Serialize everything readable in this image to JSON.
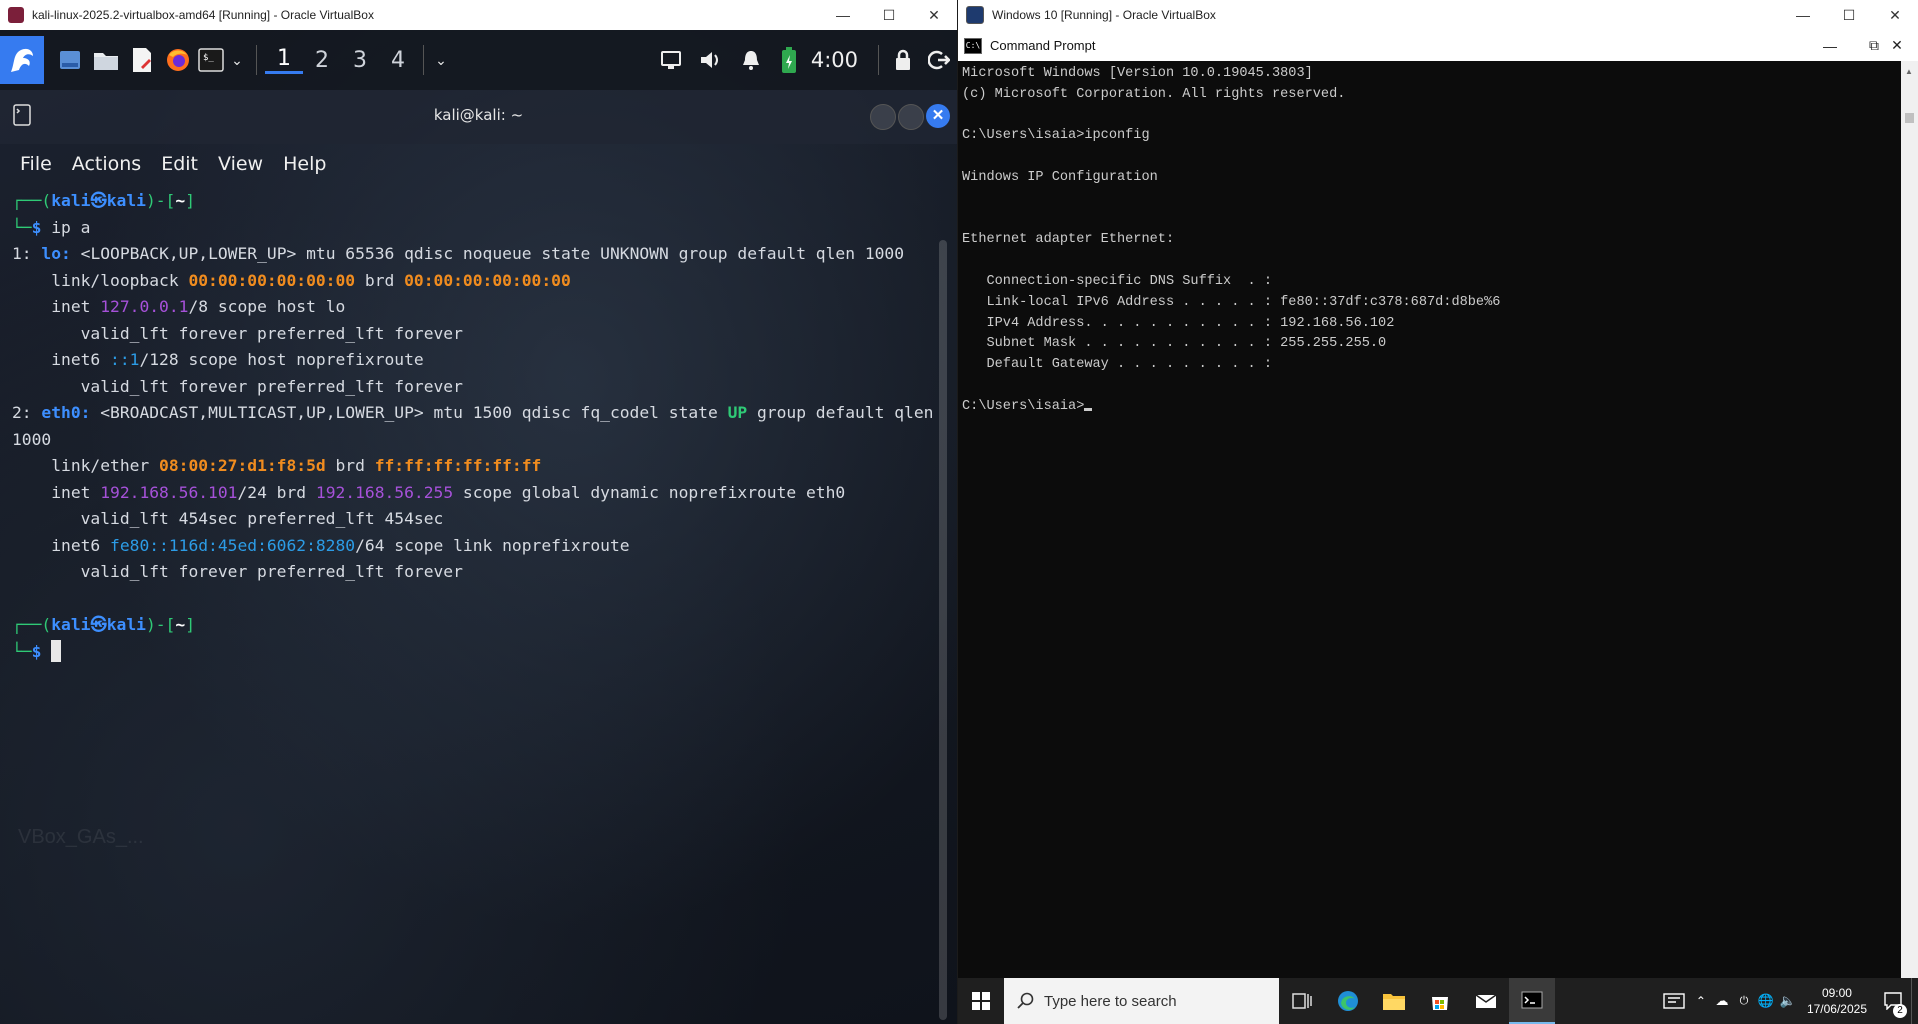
{
  "kali_window": {
    "title": "kali-linux-2025.2-virtualbox-amd64 [Running] - Oracle VirtualBox",
    "panel": {
      "workspaces": [
        "1",
        "2",
        "3",
        "4"
      ],
      "clock": "4:00"
    },
    "terminal": {
      "title": "kali@kali: ~",
      "menu": [
        "File",
        "Actions",
        "Edit",
        "View",
        "Help"
      ],
      "prompt_user": "kali",
      "prompt_host": "kali",
      "prompt_dir": "~",
      "command": "ip a",
      "lines": {
        "l1_num": "1:",
        "l1_if": "lo:",
        "l1_rest": " <LOOPBACK,UP,LOWER_UP> mtu 65536 qdisc noqueue state UNKNOWN group default qlen 1000",
        "l2_a": "    link/loopback ",
        "l2_mac": "00:00:00:00:00:00",
        "l2_b": " brd ",
        "l2_brd": "00:00:00:00:00:00",
        "l3_a": "    inet ",
        "l3_ip": "127.0.0.1",
        "l3_b": "/8 scope host lo",
        "l4": "       valid_lft forever preferred_lft forever",
        "l5_a": "    inet6 ",
        "l5_ip": "::1",
        "l5_b": "/128 scope host noprefixroute",
        "l6": "       valid_lft forever preferred_lft forever",
        "l7_num": "2:",
        "l7_if": "eth0:",
        "l7_a": " <BROADCAST,MULTICAST,UP,LOWER_UP> mtu 1500 qdisc fq_codel state ",
        "l7_up": "UP",
        "l7_b": " group default qlen",
        "l8": "1000",
        "l9_a": "    link/ether ",
        "l9_mac": "08:00:27:d1:f8:5d",
        "l9_b": " brd ",
        "l9_brd": "ff:ff:ff:ff:ff:ff",
        "l10_a": "    inet ",
        "l10_ip": "192.168.56.101",
        "l10_b": "/24 brd ",
        "l10_brd": "192.168.56.255",
        "l10_c": " scope global dynamic noprefixroute eth0",
        "l11": "       valid_lft 454sec preferred_lft 454sec",
        "l12_a": "    inet6 ",
        "l12_ip": "fe80::116d:45ed:6062:8280",
        "l12_b": "/64 scope link noprefixroute",
        "l13": "       valid_lft forever preferred_lft forever"
      }
    },
    "desktop_watermark": "VBox_GAs_..."
  },
  "windows_window": {
    "title": "Windows 10 [Running] - Oracle VirtualBox",
    "cmd": {
      "title": "Command Prompt",
      "lines": [
        "Microsoft Windows [Version 10.0.19045.3803]",
        "(c) Microsoft Corporation. All rights reserved.",
        "",
        "C:\\Users\\isaia>ipconfig",
        "",
        "Windows IP Configuration",
        "",
        "",
        "Ethernet adapter Ethernet:",
        "",
        "   Connection-specific DNS Suffix  . :",
        "   Link-local IPv6 Address . . . . . : fe80::37df:c378:687d:d8be%6",
        "   IPv4 Address. . . . . . . . . . . : 192.168.56.102",
        "   Subnet Mask . . . . . . . . . . . : 255.255.255.0",
        "   Default Gateway . . . . . . . . . :",
        ""
      ],
      "prompt": "C:\\Users\\isaia>"
    },
    "taskbar": {
      "search_placeholder": "Type here to search",
      "time": "09:00",
      "date": "17/06/2025",
      "notification_count": "2"
    }
  },
  "colors": {
    "kali_blue": "#3d8fff",
    "kali_green": "#2fca76",
    "kali_orange": "#f08c1f",
    "kali_purple": "#a651d9",
    "cmd_bg": "#0c0c0c"
  }
}
